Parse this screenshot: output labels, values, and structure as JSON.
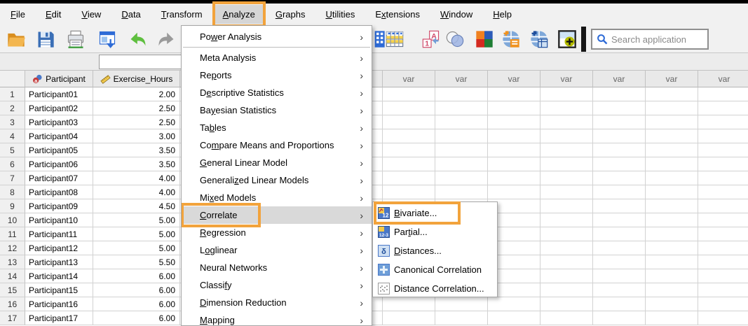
{
  "menubar": {
    "items": [
      {
        "label": "File",
        "u": 0
      },
      {
        "label": "Edit",
        "u": 0
      },
      {
        "label": "View",
        "u": 0
      },
      {
        "label": "Data",
        "u": 0
      },
      {
        "label": "Transform",
        "u": 0
      },
      {
        "label": "Analyze",
        "u": 0,
        "active": true
      },
      {
        "label": "Graphs",
        "u": 0
      },
      {
        "label": "Utilities",
        "u": 0
      },
      {
        "label": "Extensions",
        "u": 1
      },
      {
        "label": "Window",
        "u": 0
      },
      {
        "label": "Help",
        "u": 0
      }
    ]
  },
  "toolbar": {
    "icons": [
      "open-folder-icon",
      "save-icon",
      "print-icon",
      "recall-dialogs-icon",
      "undo-icon",
      "redo-icon",
      "goto-case-icon",
      "value-labels-table-icon",
      "show-value-labels-icon",
      "use-variable-sets-icon",
      "split-window-icon",
      "web-report-icon",
      "web-table-icon",
      "add-custom-icon"
    ],
    "search": {
      "placeholder": "Search application"
    }
  },
  "analyze_menu": {
    "items": [
      {
        "label": "Power Analysis",
        "u": 2,
        "separator_after": true
      },
      {
        "label": "Meta Analysis",
        "u": -1
      },
      {
        "label": "Reports",
        "u": 2
      },
      {
        "label": "Descriptive Statistics",
        "u": 1
      },
      {
        "label": "Bayesian Statistics",
        "u": 2
      },
      {
        "label": "Tables",
        "u": 2
      },
      {
        "label": "Compare Means and Proportions",
        "u": 2
      },
      {
        "label": "General Linear Model",
        "u": 0
      },
      {
        "label": "Generalized Linear Models",
        "u": 8
      },
      {
        "label": "Mixed Models",
        "u": 2
      },
      {
        "label": "Correlate",
        "u": 0,
        "highlighted": true
      },
      {
        "label": "Regression",
        "u": 0
      },
      {
        "label": "Loglinear",
        "u": 1
      },
      {
        "label": "Neural Networks",
        "u": -1
      },
      {
        "label": "Classify",
        "u": 6
      },
      {
        "label": "Dimension Reduction",
        "u": 0
      },
      {
        "label": "Mapping",
        "u": 0
      }
    ]
  },
  "correlate_submenu": {
    "items": [
      {
        "label": "Bivariate...",
        "u": 0,
        "icon": "bivariate-icon",
        "highlighted": true
      },
      {
        "label": "Partial...",
        "u": 3,
        "icon": "partial-icon"
      },
      {
        "label": "Distances...",
        "u": 0,
        "icon": "distances-icon"
      },
      {
        "label": "Canonical Correlation",
        "u": -1,
        "icon": "canonical-correlation-icon"
      },
      {
        "label": "Distance Correlation...",
        "u": -1,
        "icon": "distance-correlation-icon"
      }
    ]
  },
  "data_grid": {
    "columns": [
      {
        "name": "Participant",
        "type": "nominal"
      },
      {
        "name": "Exercise_Hours",
        "type": "scale"
      }
    ],
    "var_header": "var",
    "rows": [
      {
        "n": "1",
        "participant": "Participant01",
        "hours": "2.00"
      },
      {
        "n": "2",
        "participant": "Participant02",
        "hours": "2.50"
      },
      {
        "n": "3",
        "participant": "Participant03",
        "hours": "2.50"
      },
      {
        "n": "4",
        "participant": "Participant04",
        "hours": "3.00"
      },
      {
        "n": "5",
        "participant": "Participant05",
        "hours": "3.50"
      },
      {
        "n": "6",
        "participant": "Participant06",
        "hours": "3.50"
      },
      {
        "n": "7",
        "participant": "Participant07",
        "hours": "4.00"
      },
      {
        "n": "8",
        "participant": "Participant08",
        "hours": "4.00"
      },
      {
        "n": "9",
        "participant": "Participant09",
        "hours": "4.50"
      },
      {
        "n": "10",
        "participant": "Participant10",
        "hours": "5.00"
      },
      {
        "n": "11",
        "participant": "Participant11",
        "hours": "5.00"
      },
      {
        "n": "12",
        "participant": "Participant12",
        "hours": "5.00"
      },
      {
        "n": "13",
        "participant": "Participant13",
        "hours": "5.50"
      },
      {
        "n": "14",
        "participant": "Participant14",
        "hours": "6.00"
      },
      {
        "n": "15",
        "participant": "Participant15",
        "hours": "6.00"
      },
      {
        "n": "16",
        "participant": "Participant16",
        "hours": "6.00"
      },
      {
        "n": "17",
        "participant": "Participant17",
        "hours": "6.00"
      }
    ]
  },
  "highlight_color": "#F2A33C"
}
